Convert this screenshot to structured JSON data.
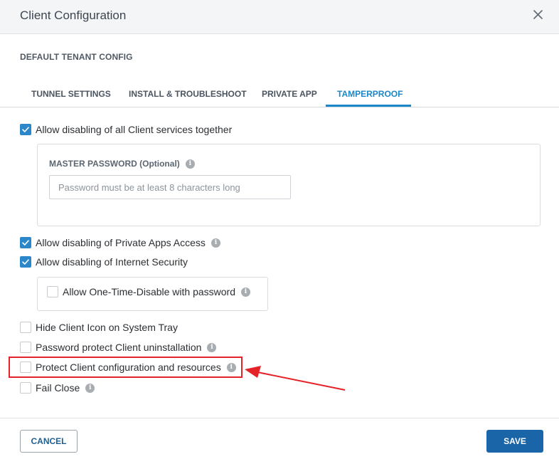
{
  "dialog": {
    "title": "Client Configuration",
    "close_icon": "close-icon"
  },
  "section_title": "DEFAULT TENANT CONFIG",
  "tabs": [
    {
      "label": "TUNNEL SETTINGS",
      "active": false
    },
    {
      "label": "INSTALL & TROUBLESHOOT",
      "active": false
    },
    {
      "label": "PRIVATE APP",
      "active": false
    },
    {
      "label": "TAMPERPROOF",
      "active": true
    }
  ],
  "options": {
    "disable_all": {
      "label": "Allow disabling of all Client services together",
      "checked": true
    },
    "master_password": {
      "label": "MASTER PASSWORD (Optional)",
      "placeholder": "Password must be at least 8 characters long",
      "value": ""
    },
    "disable_private_apps": {
      "label": "Allow disabling of Private Apps Access",
      "checked": true
    },
    "disable_internet_security": {
      "label": "Allow disabling of Internet Security",
      "checked": true
    },
    "one_time_disable": {
      "label": "Allow One-Time-Disable with password",
      "checked": false
    },
    "hide_icon": {
      "label": "Hide Client Icon on System Tray",
      "checked": false
    },
    "password_uninstall": {
      "label": "Password protect Client uninstallation",
      "checked": false
    },
    "protect_config": {
      "label": "Protect Client configuration and resources",
      "checked": false
    },
    "fail_close": {
      "label": "Fail Close",
      "checked": false
    }
  },
  "info_glyph": "i",
  "annotation": {
    "highlight_color": "#e52228"
  },
  "colors": {
    "accent": "#1d86c8",
    "primary_button": "#1a64a8",
    "checkbox_checked": "#2b87c9"
  },
  "footer": {
    "cancel_label": "CANCEL",
    "save_label": "SAVE"
  }
}
